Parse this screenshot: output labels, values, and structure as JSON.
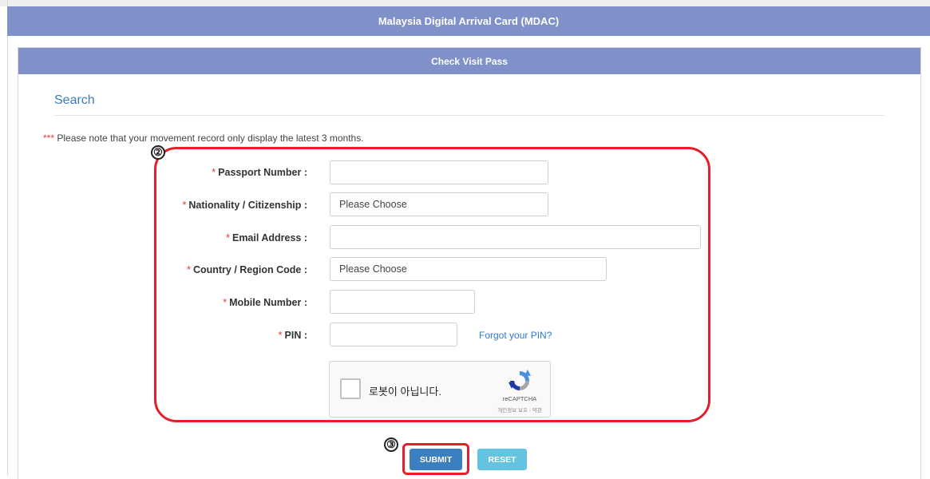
{
  "header": {
    "title": "Malaysia Digital Arrival Card (MDAC)"
  },
  "panel": {
    "title": "Check Visit Pass",
    "section_title": "Search",
    "note_stars": "***",
    "note_text": " Please note that your movement record only display the latest 3 months."
  },
  "form": {
    "required_mark": "*",
    "fields": [
      {
        "label": "Passport Number :",
        "value": ""
      },
      {
        "label": "Nationality / Citizenship :",
        "value": "Please Choose"
      },
      {
        "label": "Email Address :",
        "value": ""
      },
      {
        "label": "Country / Region Code :",
        "value": "Please Choose"
      },
      {
        "label": "Mobile Number :",
        "value": ""
      },
      {
        "label": "PIN :",
        "value": ""
      }
    ],
    "forgot_pin": "Forgot your PIN?"
  },
  "captcha": {
    "label": "로봇이 아닙니다.",
    "brand": "reCAPTCHA",
    "terms": "개인정보 보호 - 약관"
  },
  "buttons": {
    "submit": "SUBMIT",
    "reset": "RESET"
  },
  "annotations": {
    "step_form": "②",
    "step_submit": "③"
  },
  "colors": {
    "header": "#7f91c8",
    "annotation": "#e41f2a",
    "submit": "#3b7fc3",
    "reset": "#63c3e1",
    "link": "#2a7bd1"
  },
  "icons": {
    "captcha_logo": "recaptcha-icon"
  }
}
